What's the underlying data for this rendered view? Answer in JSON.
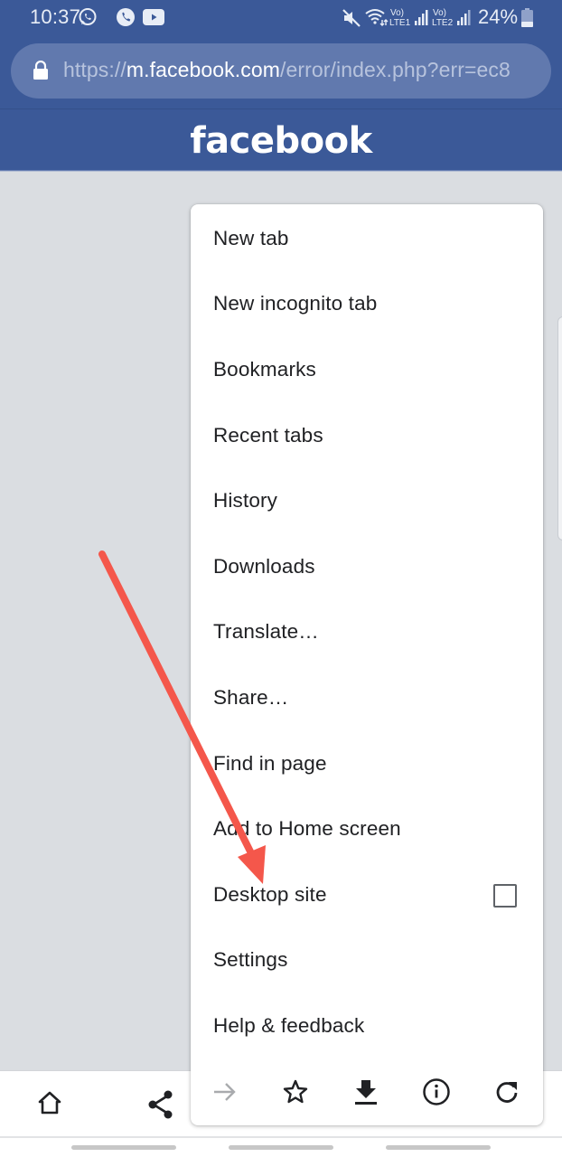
{
  "status_bar": {
    "time": "10:37",
    "notification_icons": [
      "whatsapp-icon",
      "phone-call-icon",
      "youtube-icon"
    ],
    "system_icons": [
      "mute-icon",
      "wifi-icon",
      "lte1-signal-icon",
      "lte2-signal-icon",
      "battery-icon"
    ],
    "sim1_label_top": "Vo)",
    "sim1_label_bottom": "LTE1",
    "sim2_label_top": "Vo)",
    "sim2_label_bottom": "LTE2",
    "battery_percent": "24%"
  },
  "url_bar": {
    "scheme": "https://",
    "host": "m.facebook.com",
    "path": "/error/index.php?err=ec8",
    "secure": true
  },
  "page": {
    "logo": "facebook",
    "header_color": "#3b5998",
    "background_color": "#dadde1"
  },
  "menu": {
    "items": [
      {
        "label": "New tab"
      },
      {
        "label": "New incognito tab"
      },
      {
        "label": "Bookmarks"
      },
      {
        "label": "Recent tabs"
      },
      {
        "label": "History"
      },
      {
        "label": "Downloads"
      },
      {
        "label": "Translate…"
      },
      {
        "label": "Share…"
      },
      {
        "label": "Find in page"
      },
      {
        "label": "Add to Home screen"
      },
      {
        "label": "Desktop site",
        "checkbox": true,
        "checked": false
      },
      {
        "label": "Settings"
      },
      {
        "label": "Help & feedback"
      }
    ],
    "icon_row": [
      {
        "name": "forward-arrow-icon",
        "enabled": false
      },
      {
        "name": "bookmark-star-icon",
        "enabled": true
      },
      {
        "name": "download-icon",
        "enabled": true
      },
      {
        "name": "info-icon",
        "enabled": true
      },
      {
        "name": "reload-icon",
        "enabled": true
      }
    ]
  },
  "bottom_toolbar": {
    "buttons": [
      "home-icon",
      "share-icon"
    ]
  },
  "annotation": {
    "type": "arrow",
    "color": "#f4574b",
    "points_to": "Desktop site"
  }
}
